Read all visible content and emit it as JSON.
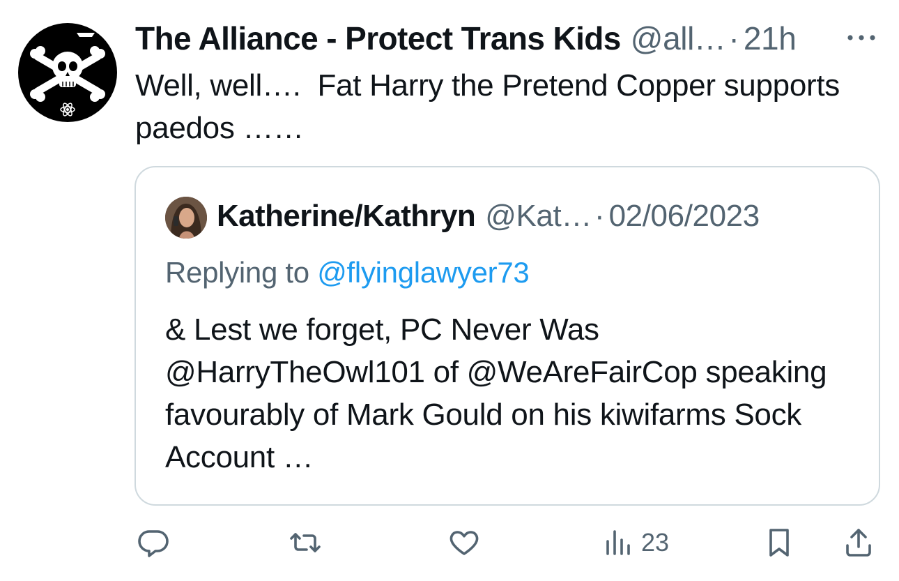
{
  "tweet": {
    "author_name": "The Alliance - Protect Trans Kids",
    "author_handle": "@all…",
    "separator": "·",
    "time": "21h",
    "text": "Well, well….  Fat Harry the Pretend Copper supports paedos ……"
  },
  "quote": {
    "author_name": "Katherine/Kathryn",
    "author_handle": "@Kat…",
    "separator": "·",
    "date": "02/06/2023",
    "replying_prefix": "Replying to",
    "replying_to": "@flyinglawyer73",
    "text": "& Lest we forget, PC Never Was @HarryTheOwl101 of @WeAreFairCop speaking favourably of Mark Gould on his kiwifarms Sock Account …"
  },
  "actions": {
    "views_count": "23"
  },
  "icons": {
    "avatar": "skull-crossbones-icon",
    "more": "more-dots-icon",
    "reply": "reply-icon",
    "retweet": "retweet-icon",
    "like": "heart-icon",
    "views": "views-bar-chart-icon",
    "bookmark": "bookmark-icon",
    "share": "share-icon"
  },
  "colors": {
    "text": "#0f1419",
    "secondary": "#536471",
    "link": "#1d9bf0",
    "border": "#cfd9de"
  }
}
